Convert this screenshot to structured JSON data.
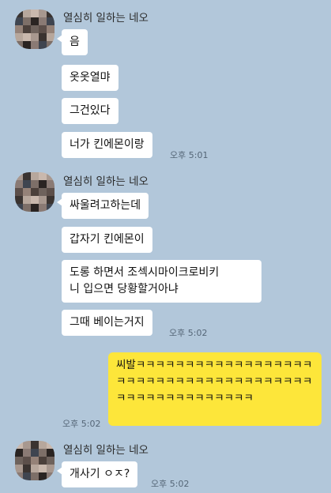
{
  "sender_name": "열심히 일하는 네오",
  "groups": [
    {
      "messages": [
        "음",
        "옷옷열먀",
        "그건있다",
        "너가 킨에몬이랑"
      ],
      "time": "오후 5:01"
    },
    {
      "messages": [
        "싸울려고하는데",
        "갑자기 킨에몬이",
        "도롱 하면서 조섹시마이크로비키\n니 입으면 당황할거아냐",
        "그때 베이는거지"
      ],
      "time": "오후 5:02"
    },
    {
      "messages": [
        "개사기 ㅇㅈ?"
      ],
      "time": "오후 5:02"
    }
  ],
  "my_message": {
    "text": "씨발ㅋㅋㅋㅋㅋㅋㅋㅋㅋㅋㅋㅋㅋㅋㅋㅋㅋㅋㅋㅋㅋㅋㅋㅋㅋㅋㅋㅋㅋㅋㅋㅋㅋㅋㅋㅋㅋㅋㅋㅋㅋㅋㅋㅋㅋㅋㅋㅋㅋㅋㅋㅋ",
    "time": "오후 5:02"
  },
  "colors": {
    "background": "#b2c7da",
    "my_bubble": "#fde63a",
    "their_bubble": "#ffffff"
  },
  "avatar_icon": "pixelated-avatar-icon"
}
